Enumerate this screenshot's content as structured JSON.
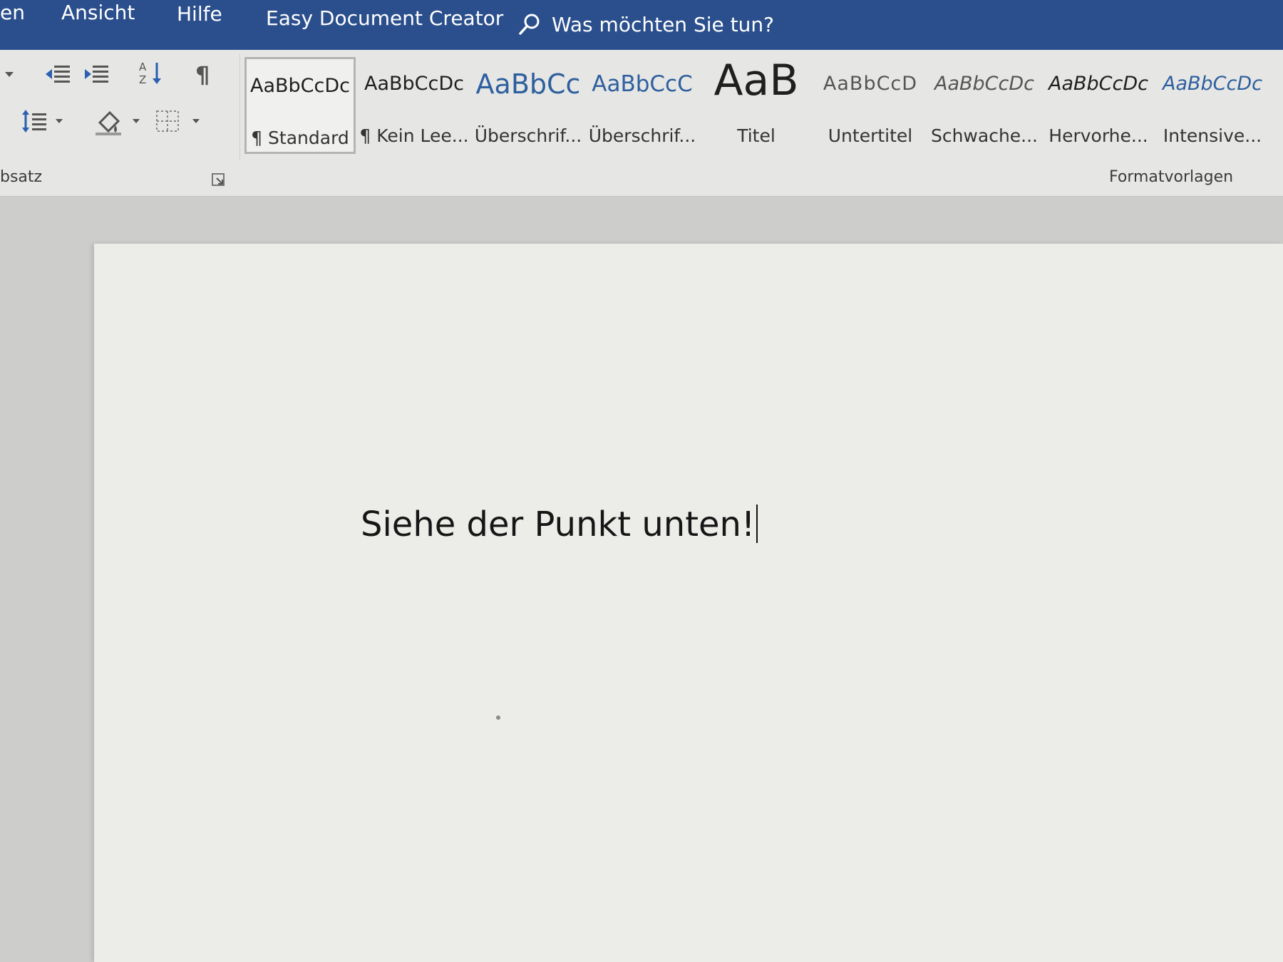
{
  "app": {
    "accent_color": "#2b4f8c"
  },
  "tabs": {
    "partial": "en",
    "view": "Ansicht",
    "help": "Hilfe",
    "addin": "Easy Document Creator"
  },
  "tell_me": {
    "icon": "search-icon",
    "placeholder": "Was möchten Sie tun?"
  },
  "ribbon": {
    "paragraph_group": {
      "label": "bsatz",
      "icons": [
        "dropdown-arrow-icon",
        "decrease-indent-icon",
        "increase-indent-icon",
        "sort-icon",
        "pilcrow-icon",
        "line-spacing-icon",
        "shading-icon",
        "borders-icon"
      ]
    },
    "styles_group": {
      "label": "Formatvorlagen",
      "items": [
        {
          "preview": "AaBbCcDc",
          "name": "¶ Standard",
          "selected": true
        },
        {
          "preview": "AaBbCcDc",
          "name": "¶ Kein Lee..."
        },
        {
          "preview": "AaBbCc",
          "name": "Überschrif..."
        },
        {
          "preview": "AaBbCcC",
          "name": "Überschrif..."
        },
        {
          "preview": "AaB",
          "name": "Titel"
        },
        {
          "preview": "AaBbCcD",
          "name": "Untertitel"
        },
        {
          "preview": "AaBbCcDc",
          "name": "Schwache..."
        },
        {
          "preview": "AaBbCcDc",
          "name": "Hervorhe..."
        },
        {
          "preview": "AaBbCcDc",
          "name": "Intensive..."
        }
      ]
    }
  },
  "document": {
    "text": "Siehe der Punkt unten!"
  }
}
